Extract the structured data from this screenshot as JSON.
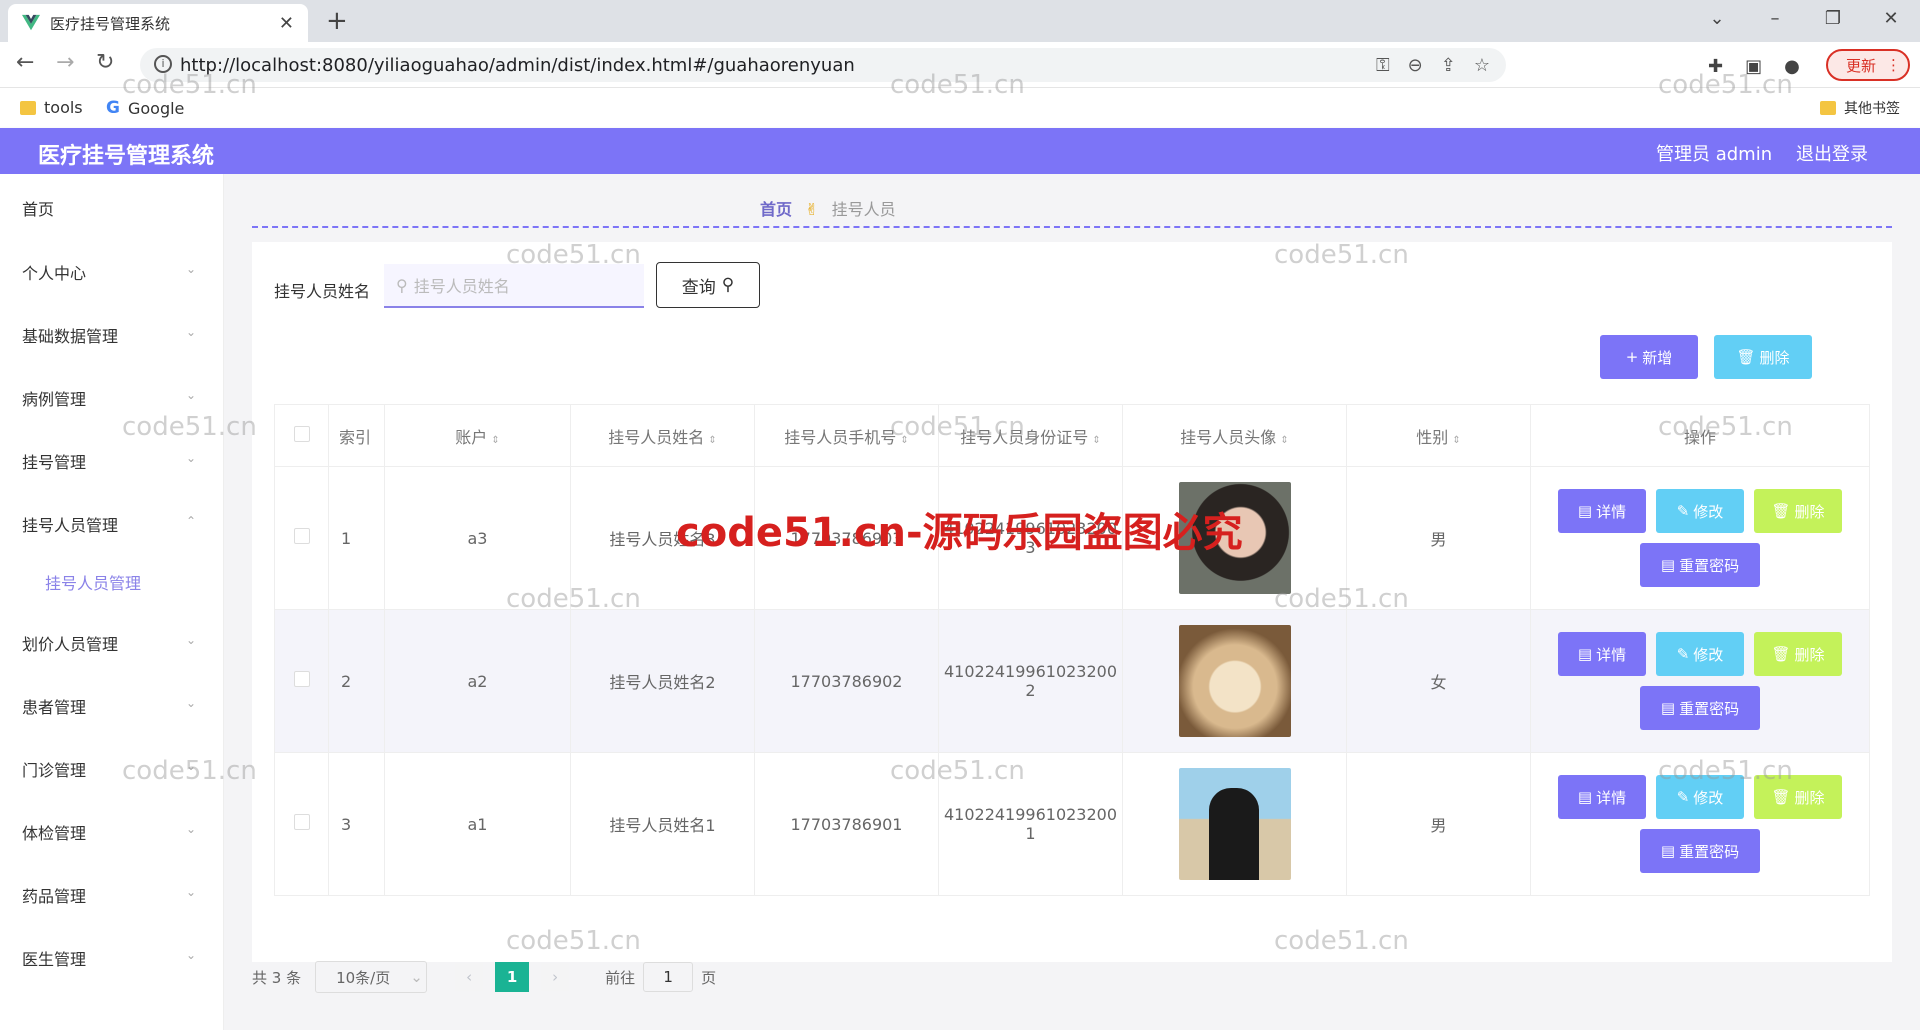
{
  "browser": {
    "tab_title": "医疗挂号管理系统",
    "url": "http://localhost:8080/yiliaoguahao/admin/dist/index.html#/guahaorenyuan",
    "update_label": "更新",
    "bookmarks": [
      "tools",
      "Google"
    ],
    "other_bookmarks": "其他书签"
  },
  "header": {
    "app_title": "医疗挂号管理系统",
    "admin_label": "管理员 admin",
    "logout_label": "退出登录"
  },
  "sidebar": {
    "items": [
      {
        "label": "首页"
      },
      {
        "label": "个人中心"
      },
      {
        "label": "基础数据管理"
      },
      {
        "label": "病例管理"
      },
      {
        "label": "挂号管理"
      },
      {
        "label": "挂号人员管理"
      },
      {
        "label": "划价人员管理"
      },
      {
        "label": "患者管理"
      },
      {
        "label": "门诊管理"
      },
      {
        "label": "体检管理"
      },
      {
        "label": "药品管理"
      },
      {
        "label": "医生管理"
      }
    ],
    "submenu_label": "挂号人员管理"
  },
  "breadcrumb": {
    "home": "首页",
    "current": "挂号人员"
  },
  "search": {
    "label": "挂号人员姓名",
    "placeholder": "挂号人员姓名",
    "button": "查询"
  },
  "actions": {
    "add": "新增",
    "delete": "删除"
  },
  "table": {
    "headers": [
      "索引",
      "账户",
      "挂号人员姓名",
      "挂号人员手机号",
      "挂号人员身份证号",
      "挂号人员头像",
      "性别",
      "操作"
    ],
    "rows": [
      {
        "index": "1",
        "account": "a3",
        "name": "挂号人员姓名3",
        "phone": "17703786903",
        "id_line1": "41022419961023200",
        "id_line2": "3",
        "gender": "男"
      },
      {
        "index": "2",
        "account": "a2",
        "name": "挂号人员姓名2",
        "phone": "17703786902",
        "id_line1": "41022419961023200",
        "id_line2": "2",
        "gender": "女"
      },
      {
        "index": "3",
        "account": "a1",
        "name": "挂号人员姓名1",
        "phone": "17703786901",
        "id_line1": "41022419961023200",
        "id_line2": "1",
        "gender": "男"
      }
    ],
    "op_labels": {
      "detail": "详情",
      "edit": "修改",
      "delete": "删除",
      "reset": "重置密码"
    }
  },
  "pagination": {
    "total": "共 3 条",
    "page_size": "10条/页",
    "current_page": "1",
    "goto_label": "前往",
    "goto_value": "1",
    "page_suffix": "页"
  },
  "watermark": {
    "small": "code51.cn",
    "big": "code51.cn-源码乐园盗图必究"
  }
}
